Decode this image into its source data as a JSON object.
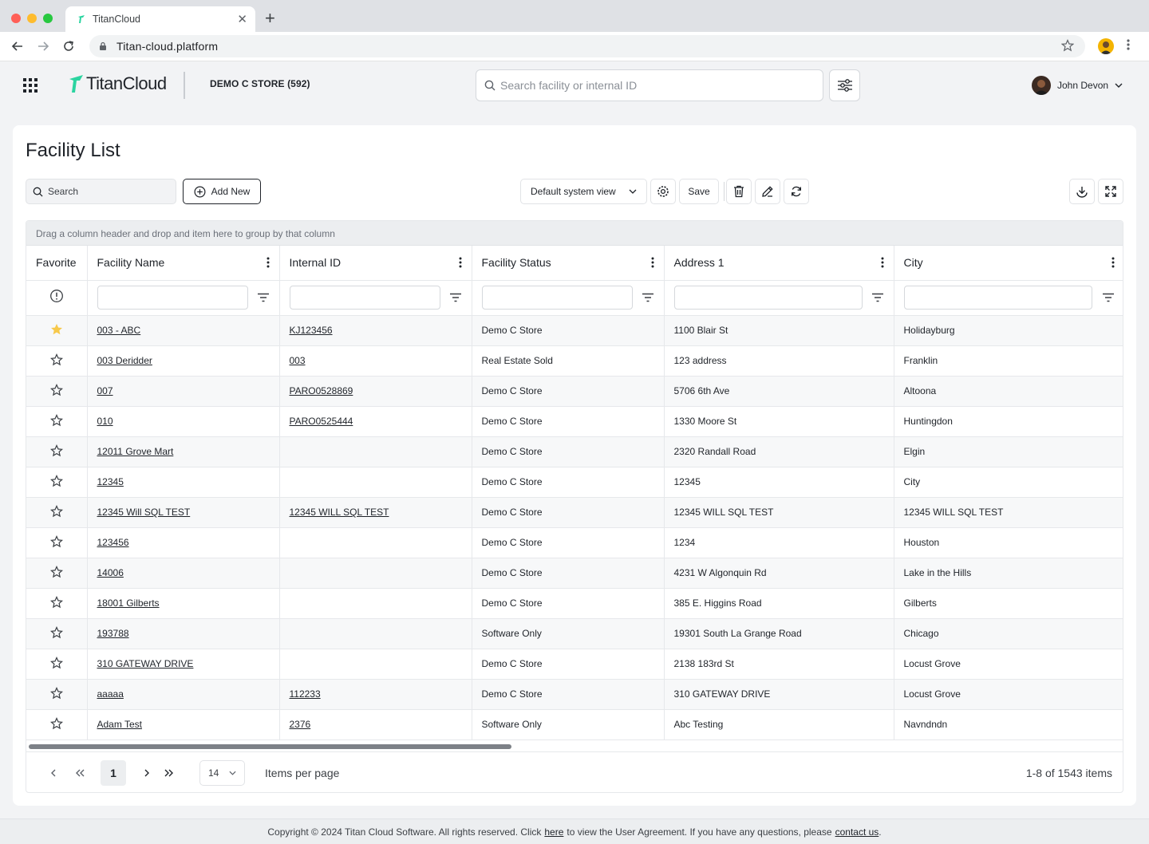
{
  "browser": {
    "tab_title": "TitanCloud",
    "url": "Titan-cloud.platform"
  },
  "header": {
    "logo_text": "TitanCloud",
    "store": "DEMO C STORE (592)",
    "search_placeholder": "Search facility or internal ID",
    "user_name": "John Devon"
  },
  "page": {
    "title": "Facility List"
  },
  "toolbar": {
    "search_placeholder": "Search",
    "add_new": "Add New",
    "view": "Default system view",
    "save": "Save"
  },
  "grid": {
    "group_hint": "Drag a column header and drop and item here to group by that column",
    "columns": [
      "Favorite",
      "Facility Name",
      "Internal ID",
      "Facility Status",
      "Address 1",
      "City"
    ],
    "rows": [
      {
        "fav": true,
        "name": "003 - ABC",
        "id": "KJ123456",
        "status": "Demo C Store",
        "addr": "1100 Blair St",
        "city": "Holidayburg"
      },
      {
        "fav": false,
        "name": "003 Deridder",
        "id": "003",
        "status": "Real Estate Sold",
        "addr": "123 address",
        "city": "Franklin"
      },
      {
        "fav": false,
        "name": "007",
        "id": "PARO0528869",
        "status": "Demo C Store",
        "addr": "5706 6th Ave",
        "city": "Altoona"
      },
      {
        "fav": false,
        "name": "010",
        "id": "PARO0525444",
        "status": "Demo C Store",
        "addr": "1330 Moore St",
        "city": "Huntingdon"
      },
      {
        "fav": false,
        "name": "12011 Grove Mart",
        "id": "",
        "status": "Demo C Store",
        "addr": "2320 Randall Road",
        "city": "Elgin"
      },
      {
        "fav": false,
        "name": "12345",
        "id": "",
        "status": "Demo C Store",
        "addr": "12345",
        "city": "City"
      },
      {
        "fav": false,
        "name": "12345 Will SQL TEST",
        "id": "12345 WILL SQL TEST",
        "status": "Demo C Store",
        "addr": "12345 WILL SQL TEST",
        "city": "12345 WILL SQL TEST"
      },
      {
        "fav": false,
        "name": "123456",
        "id": "",
        "status": "Demo C Store",
        "addr": "1234",
        "city": "Houston"
      },
      {
        "fav": false,
        "name": "14006",
        "id": "",
        "status": "Demo C Store",
        "addr": "4231 W Algonquin Rd",
        "city": "Lake in the Hills"
      },
      {
        "fav": false,
        "name": "18001 Gilberts",
        "id": "",
        "status": "Demo C Store",
        "addr": "385 E. Higgins Road",
        "city": "Gilberts"
      },
      {
        "fav": false,
        "name": "193788",
        "id": "",
        "status": "Software Only",
        "addr": "19301 South La Grange Road",
        "city": "Chicago"
      },
      {
        "fav": false,
        "name": "310 GATEWAY DRIVE",
        "id": "",
        "status": "Demo C Store",
        "addr": "2138 183rd St",
        "city": "Locust Grove"
      },
      {
        "fav": false,
        "name": "aaaaa",
        "id": "112233",
        "status": "Demo C Store",
        "addr": "310 GATEWAY DRIVE",
        "city": "Locust Grove"
      },
      {
        "fav": false,
        "name": "Adam Test",
        "id": "2376",
        "status": "Software Only",
        "addr": "Abc Testing",
        "city": "Navndndn"
      }
    ]
  },
  "pager": {
    "current": "1",
    "page_size": "14",
    "items_per_page": "Items per page",
    "count": "1-8 of 1543 items"
  },
  "footer": {
    "prefix": "Copyright © 2024 Titan Cloud Software. All rights reserved. Click",
    "here": "here",
    "middle": "to view the User Agreement. If you have any questions, please",
    "contact": "contact us",
    "suffix": "."
  },
  "colors": {
    "brand_green": "#2bd4a0",
    "favorite_star": "#f7c94b"
  }
}
